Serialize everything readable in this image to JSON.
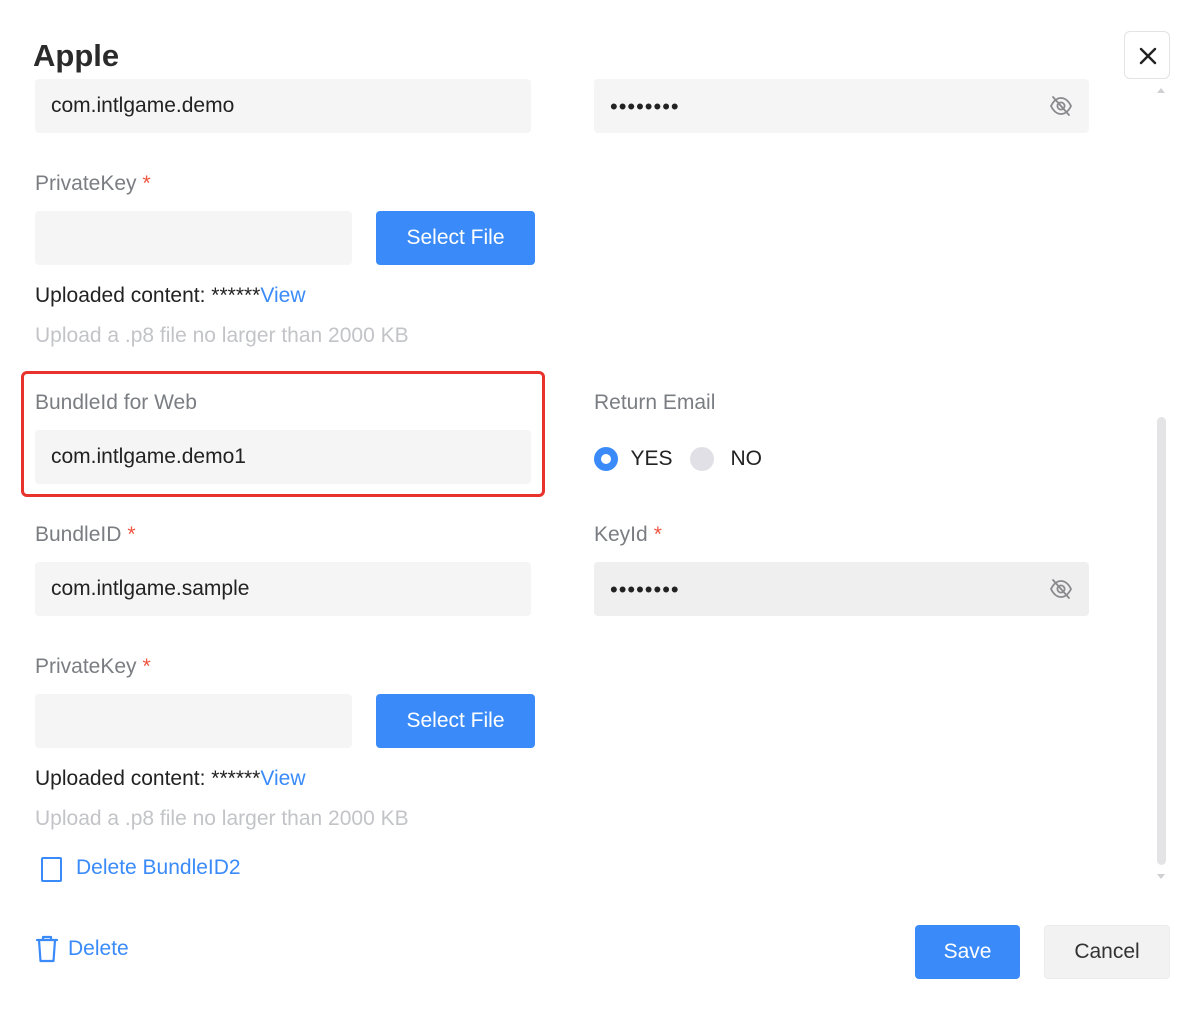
{
  "dialog": {
    "title": "Apple",
    "close_icon": "close-icon"
  },
  "first_block": {
    "bundle_id_value": "com.intlgame.demo",
    "keyid_masked": "••••••••",
    "private_key": {
      "label": "PrivateKey",
      "required_mark": "*",
      "file_value": "",
      "select_file_label": "Select File",
      "uploaded_prefix": "Uploaded content: ******",
      "view_label": "View",
      "hint": "Upload a .p8 file no larger than 2000 KB"
    }
  },
  "web_bundle": {
    "label": "BundleId for Web",
    "value": "com.intlgame.demo1"
  },
  "return_email": {
    "label": "Return Email",
    "options": [
      {
        "label": "YES",
        "selected": true
      },
      {
        "label": "NO",
        "selected": false
      }
    ]
  },
  "second_block": {
    "bundle_id_label": "BundleID",
    "bundle_id_required": "*",
    "bundle_id_value": "com.intlgame.sample",
    "keyid_label": "KeyId",
    "keyid_required": "*",
    "keyid_masked": "••••••••",
    "private_key": {
      "label": "PrivateKey",
      "required_mark": "*",
      "file_value": "",
      "select_file_label": "Select File",
      "uploaded_prefix": "Uploaded content: ******",
      "view_label": "View",
      "hint": "Upload a .p8 file no larger than 2000 KB"
    },
    "delete_bundle_label": "Delete BundleID2"
  },
  "footer": {
    "delete_label": "Delete",
    "save_label": "Save",
    "cancel_label": "Cancel"
  },
  "colors": {
    "accent": "#3a8bf9",
    "highlight": "#e8322c",
    "required": "#f0553f"
  },
  "icons": [
    "close-icon",
    "eye-off-icon",
    "trash-icon",
    "radio-icon",
    "checkbox-icon"
  ]
}
